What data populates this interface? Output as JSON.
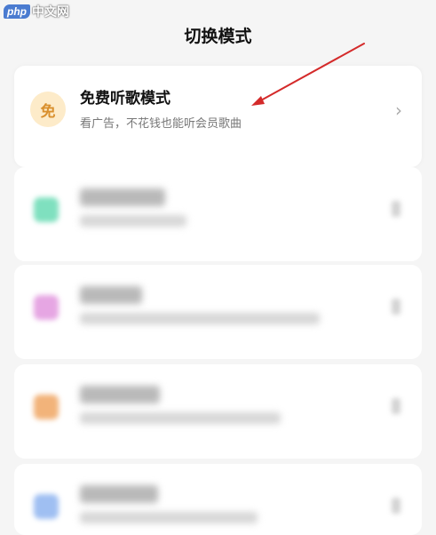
{
  "watermark": {
    "logo": "php",
    "text": "中文网"
  },
  "page": {
    "title": "切换模式"
  },
  "modes": [
    {
      "icon_char": "免",
      "name": "免费听歌模式",
      "description": "看广告，不花钱也能听会员歌曲",
      "chevron": "›",
      "icon_color": "#fdebc9"
    },
    {
      "icon_color": "#7fe0bf",
      "blurred": true
    },
    {
      "icon_color": "#e6a6e3",
      "blurred": true
    },
    {
      "icon_color": "#f2b37a",
      "blurred": true
    },
    {
      "icon_color": "#9fbff2",
      "blurred": true
    }
  ],
  "annotation": {
    "color": "#d42a2a"
  }
}
